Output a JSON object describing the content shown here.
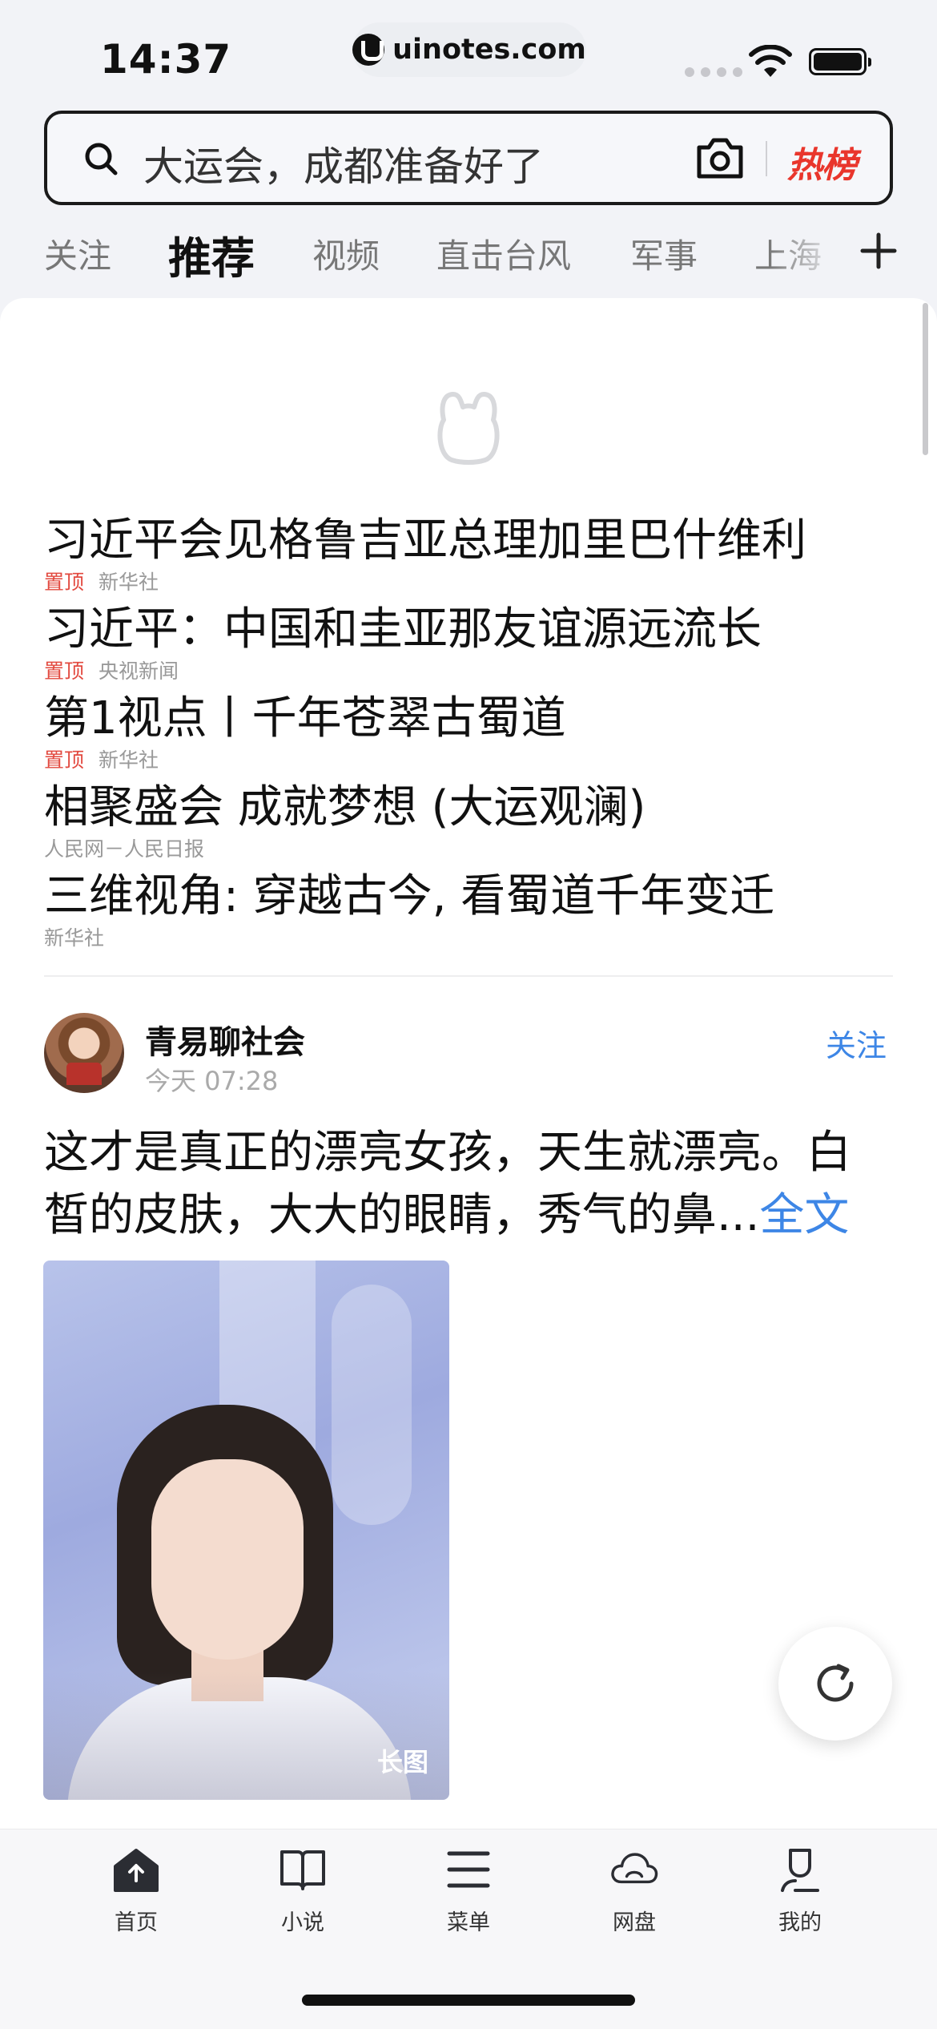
{
  "status_bar": {
    "time": "14:37",
    "url": "uinotes.com"
  },
  "search": {
    "placeholder_text": "大运会，成都准备好了",
    "hot_label": "热榜"
  },
  "tabs": [
    {
      "label": "关注",
      "active": false
    },
    {
      "label": "推荐",
      "active": true
    },
    {
      "label": "视频",
      "active": false
    },
    {
      "label": "直击台风",
      "active": false
    },
    {
      "label": "军事",
      "active": false
    },
    {
      "label": "上海",
      "active": false
    }
  ],
  "news": [
    {
      "title": "习近平会见格鲁吉亚总理加里巴什维利",
      "pin": "置顶",
      "source": "新华社"
    },
    {
      "title": "习近平：中国和圭亚那友谊源远流长",
      "pin": "置顶",
      "source": "央视新闻"
    },
    {
      "title": "第1视点丨千年苍翠古蜀道",
      "pin": "置顶",
      "source": "新华社"
    },
    {
      "title": "相聚盛会 成就梦想 (大运观澜)",
      "pin": "",
      "source": "人民网－人民日报"
    },
    {
      "title": "三维视角: 穿越古今, 看蜀道千年变迁",
      "pin": "",
      "source": "新华社"
    }
  ],
  "post": {
    "author": "青易聊社会",
    "time": "今天 07:28",
    "follow_label": "关注",
    "text": "这才是真正的漂亮女孩，天生就漂亮。白皙的皮肤，大大的眼睛，秀气的鼻...",
    "more_label": "全文",
    "image_badge": "长图"
  },
  "bottom_nav": [
    {
      "label": "首页",
      "icon": "home-icon",
      "active": true
    },
    {
      "label": "小说",
      "icon": "book-icon",
      "active": false
    },
    {
      "label": "菜单",
      "icon": "menu-icon",
      "active": false
    },
    {
      "label": "网盘",
      "icon": "cloud-icon",
      "active": false
    },
    {
      "label": "我的",
      "icon": "profile-icon",
      "active": false
    }
  ],
  "colors": {
    "accent_blue": "#3d86e6",
    "hot_red": "#e9362c",
    "pin_red": "#e2483e"
  }
}
